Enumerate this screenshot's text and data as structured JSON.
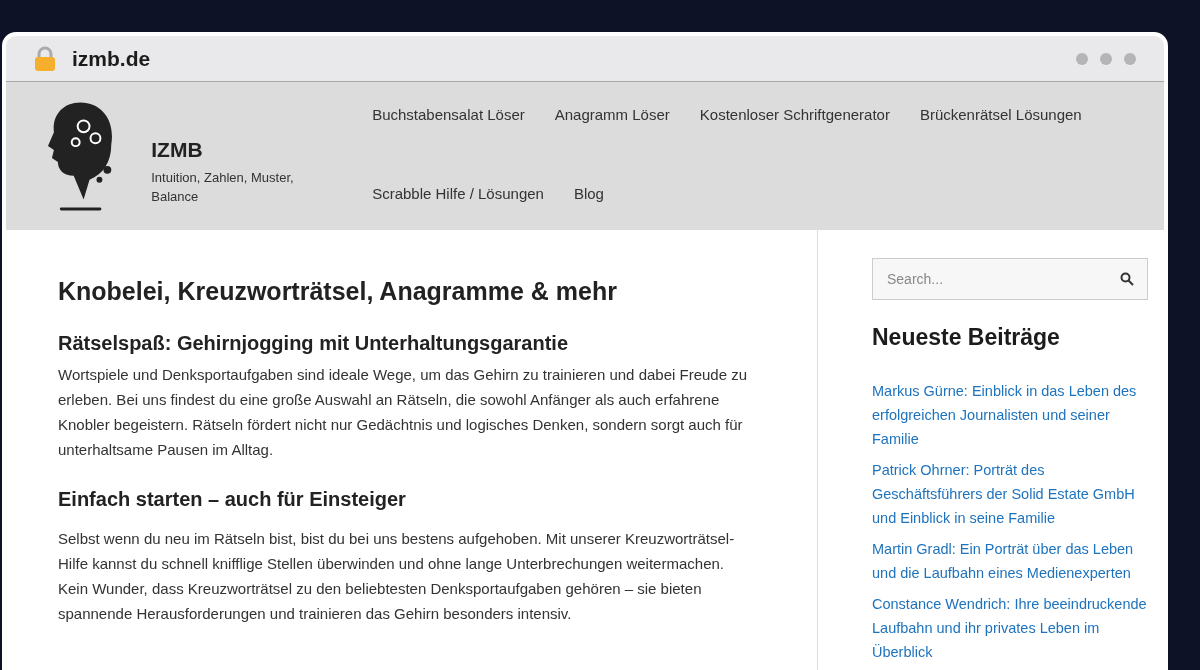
{
  "browser": {
    "url": "izmb.de"
  },
  "site": {
    "title": "IZMB",
    "tagline": "Intuition, Zahlen, Muster, Balance"
  },
  "nav": [
    {
      "label": "Buchstabensalat Löser"
    },
    {
      "label": "Anagramm Löser"
    },
    {
      "label": "Kostenloser Schriftgenerator"
    },
    {
      "label": "Brückenrätsel Lösungen"
    },
    {
      "label": "Scrabble Hilfe / Lösungen"
    },
    {
      "label": "Blog"
    }
  ],
  "main": {
    "title": "Knobelei, Kreuzworträtsel, Anagramme & mehr",
    "sections": [
      {
        "heading": "Rätselspaß: Gehirnjogging mit Unterhaltungsgarantie",
        "text": "Wortspiele und Denksportaufgaben sind ideale Wege, um das Gehirn zu trainieren und dabei Freude zu erleben. Bei uns findest du eine große Auswahl an Rätseln, die sowohl Anfänger als auch erfahrene Knobler begeistern. Rätseln fördert nicht nur Gedächtnis und logisches Denken, sondern sorgt auch für unterhaltsame Pausen im Alltag."
      },
      {
        "heading": "Einfach starten – auch für Einsteiger",
        "text": "Selbst wenn du neu im Rätseln bist, bist du bei uns bestens aufgehoben. Mit unserer Kreuzworträtsel-Hilfe kannst du schnell knifflige Stellen überwinden und ohne lange Unterbrechungen weitermachen. Kein Wunder, dass Kreuzworträtsel zu den beliebtesten Denksportaufgaben gehören – sie bieten spannende Herausforderungen und trainieren das Gehirn besonders intensiv."
      }
    ]
  },
  "sidebar": {
    "search": {
      "placeholder": "Search..."
    },
    "title": "Neueste Beiträge",
    "posts": [
      "Markus Gürne: Einblick in das Leben des erfolgreichen Journalisten und seiner Familie",
      "Patrick Ohrner: Porträt des Geschäftsführers der Solid Estate GmbH und Einblick in seine Familie",
      "Martin Gradl: Ein Porträt über das Leben und die Laufbahn eines Medienexperten",
      "Constance Wendrich: Ihre beeindruckende Laufbahn und ihr privates Leben im Überblick"
    ]
  }
}
